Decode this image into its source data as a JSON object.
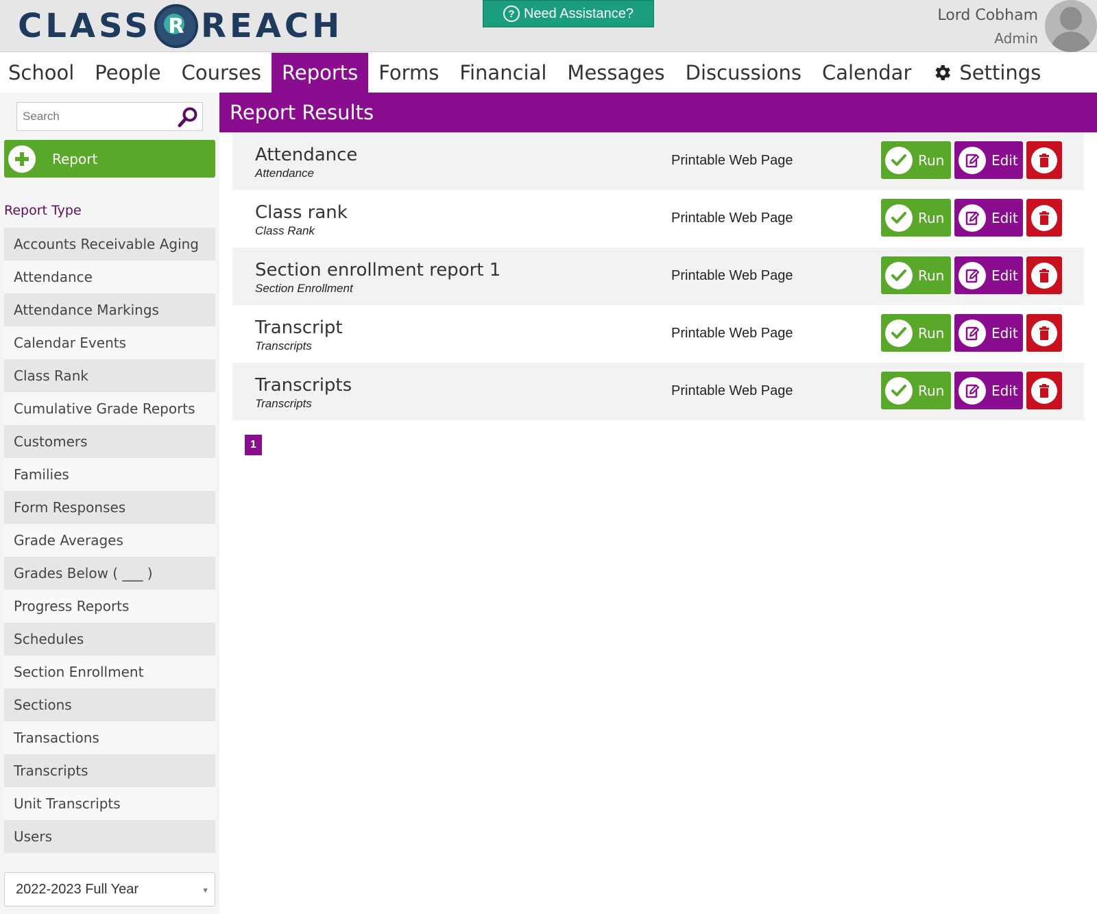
{
  "header": {
    "logo_left": "CLASS",
    "logo_mark": "R",
    "logo_right": "REACH",
    "assist_label": "Need Assistance?",
    "user_name": "Lord Cobham",
    "user_role": "Admin"
  },
  "nav": {
    "items": [
      {
        "label": "School"
      },
      {
        "label": "People"
      },
      {
        "label": "Courses"
      },
      {
        "label": "Reports",
        "active": true
      },
      {
        "label": "Forms"
      },
      {
        "label": "Financial"
      },
      {
        "label": "Messages"
      },
      {
        "label": "Discussions"
      },
      {
        "label": "Calendar"
      },
      {
        "label": "Settings",
        "icon": "gear-icon"
      }
    ]
  },
  "sidebar": {
    "search_placeholder": "Search",
    "add_report_label": "Report",
    "report_type_heading": "Report Type",
    "report_types": [
      "Accounts Receivable Aging",
      "Attendance",
      "Attendance Markings",
      "Calendar Events",
      "Class Rank",
      "Cumulative Grade Reports",
      "Customers",
      "Families",
      "Form Responses",
      "Grade Averages",
      "Grades Below ( ___ )",
      "Progress Reports",
      "Schedules",
      "Section Enrollment",
      "Sections",
      "Transactions",
      "Transcripts",
      "Unit Transcripts",
      "Users"
    ],
    "year_select": "2022-2023 Full Year"
  },
  "main": {
    "title": "Report Results",
    "run_label": "Run",
    "edit_label": "Edit",
    "results": [
      {
        "name": "Attendance",
        "type": "Attendance",
        "format": "Printable Web Page"
      },
      {
        "name": "Class rank",
        "type": "Class Rank",
        "format": "Printable Web Page"
      },
      {
        "name": "Section enrollment report 1",
        "type": "Section Enrollment",
        "format": "Printable Web Page"
      },
      {
        "name": "Transcript",
        "type": "Transcripts",
        "format": "Printable Web Page"
      },
      {
        "name": "Transcripts",
        "type": "Transcripts",
        "format": "Printable Web Page"
      }
    ],
    "page_number": "1"
  },
  "colors": {
    "brand_purple": "#8a0d8f",
    "run_green": "#5aa82a",
    "delete_red": "#c8101e",
    "assist_teal": "#1b9e7e"
  }
}
